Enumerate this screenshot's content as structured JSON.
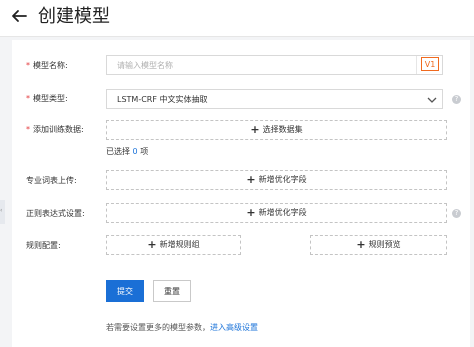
{
  "header": {
    "title": "创建模型"
  },
  "form": {
    "model_name": {
      "label": "模型名称:",
      "placeholder": "请输入模型名称",
      "version": "V1"
    },
    "model_type": {
      "label": "模型类型:",
      "value": "LSTM-CRF 中文实体抽取"
    },
    "training_data": {
      "label": "添加训练数据:",
      "button": "选择数据集",
      "selected_prefix": "已选择",
      "selected_count": "0",
      "selected_suffix": "项"
    },
    "vocab_upload": {
      "label": "专业词表上传:",
      "button": "新增优化字段"
    },
    "regex_setting": {
      "label": "正则表达式设置:",
      "button": "新增优化字段"
    },
    "rule_config": {
      "label": "规则配置:",
      "add_button": "新增规则组",
      "preview_button": "规则预览"
    }
  },
  "actions": {
    "submit": "提交",
    "reset": "重置"
  },
  "footer": {
    "note": "若需要设置更多的模型参数，",
    "link": "进入高级设置"
  },
  "colors": {
    "primary": "#1a6fd6",
    "required": "#e4393c",
    "version_badge": "#f06a1f"
  }
}
